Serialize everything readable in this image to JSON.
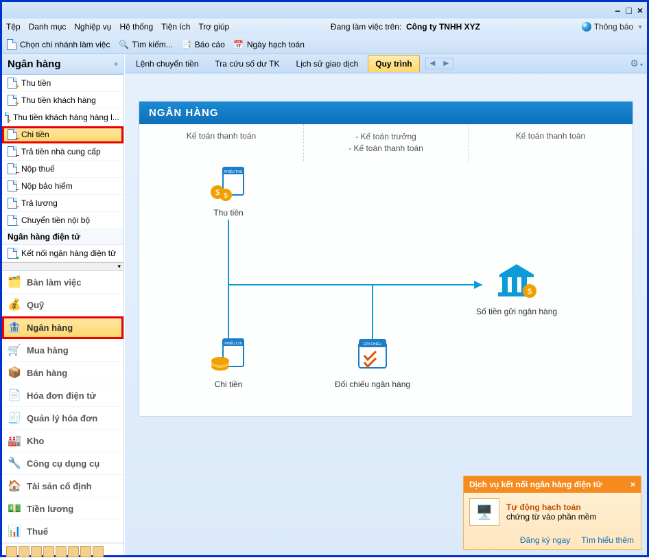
{
  "window": {
    "minimize": "–",
    "maximize": "□",
    "close": "×"
  },
  "menubar": {
    "items": [
      "Tệp",
      "Danh mục",
      "Nghiệp vụ",
      "Hệ thống",
      "Tiện ích",
      "Trợ giúp"
    ],
    "context_prefix": "Đang làm việc trên:",
    "context_company": "Công ty TNHH XYZ",
    "thongbao": "Thông báo"
  },
  "toolbar": {
    "chon_chi_nhanh": "Chọn chi nhánh làm việc",
    "tim_kiem": "Tìm kiếm...",
    "bao_cao": "Báo cáo",
    "ngay_hach_toan": "Ngày hạch toán"
  },
  "sidebar": {
    "title": "Ngân hàng",
    "items": [
      {
        "label": "Thu tiền",
        "icon": "plus"
      },
      {
        "label": "Thu tiền khách hàng",
        "icon": "plus"
      },
      {
        "label": "Thu tiền khách hàng hàng l...",
        "icon": "plus"
      },
      {
        "label": "Chi tiền",
        "icon": "minus",
        "sel": true,
        "highlighted": true
      },
      {
        "label": "Trả tiền nhà cung cấp",
        "icon": "minus"
      },
      {
        "label": "Nộp thuế",
        "icon": "minus"
      },
      {
        "label": "Nộp bảo hiểm",
        "icon": "minus"
      },
      {
        "label": "Trả lương",
        "icon": "minus"
      },
      {
        "label": "Chuyển tiền nội bộ",
        "icon": "swap"
      }
    ],
    "section2_title": "Ngân hàng điện tử",
    "section2_items": [
      {
        "label": "Kết nối ngân hàng điện tử",
        "icon": "link"
      }
    ],
    "nav_modules": [
      {
        "label": "Bàn làm việc",
        "icon": "🗂️"
      },
      {
        "label": "Quỹ",
        "icon": "💰"
      },
      {
        "label": "Ngân hàng",
        "icon": "🏦",
        "sel": true,
        "highlighted": true
      },
      {
        "label": "Mua hàng",
        "icon": "🛒"
      },
      {
        "label": "Bán hàng",
        "icon": "📦"
      },
      {
        "label": "Hóa đơn điện tử",
        "icon": "📄"
      },
      {
        "label": "Quản lý hóa đơn",
        "icon": "🧾"
      },
      {
        "label": "Kho",
        "icon": "🏭"
      },
      {
        "label": "Công cụ dụng cụ",
        "icon": "🔧"
      },
      {
        "label": "Tài sản cố định",
        "icon": "🏠"
      },
      {
        "label": "Tiền lương",
        "icon": "💵"
      },
      {
        "label": "Thuế",
        "icon": "📊"
      }
    ]
  },
  "tabs": {
    "items": [
      "Lệnh chuyển tiền",
      "Tra cứu số dư TK",
      "Lịch sử giao dịch",
      "Quy trình"
    ],
    "selected": 3
  },
  "workflow": {
    "title": "NGÂN HÀNG",
    "cols": {
      "left": "Kế toán thanh toán",
      "mid": [
        "- Kế toán trưởng",
        "- Kế toán thanh toán"
      ],
      "right": "Kế toán thanh toán"
    },
    "nodes": {
      "thu_tien": "Thu tiền",
      "chi_tien": "Chi tiền",
      "doi_chieu": "Đối chiếu ngân hàng",
      "so_tien_gui": "Số tiền gửi ngân hàng",
      "phieu_thu": "PHIẾU THU",
      "phieu_chi": "PHIẾU CHI",
      "doi_chieu_tag": "ĐỐI CHIẾU"
    }
  },
  "notify": {
    "title": "Dịch vụ kết nối ngân hàng điện tử",
    "line1": "Tự động hạch toán",
    "line2": "chứng từ vào phần mềm",
    "link1": "Đăng ký ngay",
    "link2": "Tìm hiểu thêm"
  }
}
